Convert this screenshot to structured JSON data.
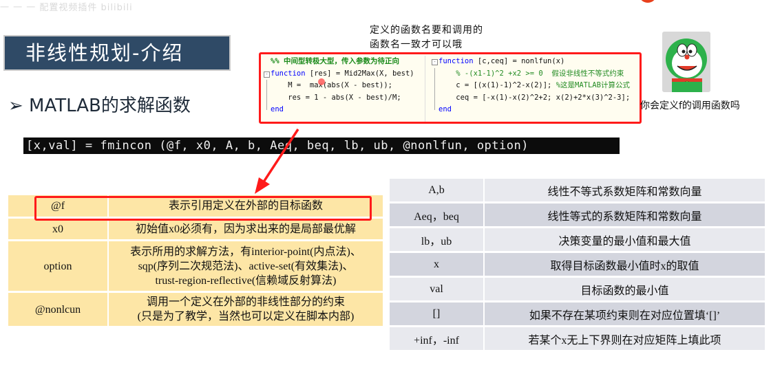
{
  "watermark": "一 一 一 配置视频插件 bilibili",
  "title": "非线性规划-介绍",
  "annotation_note": "定义的函数名要和调用的\n函数名一致才可以哦",
  "subtitle": "➢ MATLAB的求解函数",
  "code": {
    "left": [
      {
        "fold": "",
        "parts": [
          {
            "cls": "cmt-bold",
            "t": "%% 中间型转极大型，传入参数为待正向"
          }
        ]
      },
      {
        "fold": "-",
        "parts": [
          {
            "cls": "kw",
            "t": "function"
          },
          {
            "cls": "plain",
            "t": " [res] = Mid2Max(X, best)"
          }
        ]
      },
      {
        "fold": "|",
        "parts": [
          {
            "cls": "plain",
            "t": "    M =  max(abs(X - best));"
          }
        ]
      },
      {
        "fold": "|",
        "parts": [
          {
            "cls": "plain",
            "t": "    res = 1 - abs(X - best)/M;"
          }
        ]
      },
      {
        "fold": "L",
        "parts": [
          {
            "cls": "kw",
            "t": "end"
          }
        ]
      }
    ],
    "right": [
      {
        "fold": "-",
        "parts": [
          {
            "cls": "kw",
            "t": "function"
          },
          {
            "cls": "plain",
            "t": " [c,ceq] = nonlfun(x)"
          }
        ]
      },
      {
        "fold": "|",
        "parts": [
          {
            "cls": "cmt",
            "t": "    % -(x1-1)^2 +x2 >= 0  假设非线性不等式约束"
          }
        ]
      },
      {
        "fold": "|",
        "parts": [
          {
            "cls": "plain",
            "t": "    c = [(x(1)-1)^2-x(2)]; "
          },
          {
            "cls": "cmt",
            "t": "%这是MATLAB计算公式"
          }
        ]
      },
      {
        "fold": "|",
        "parts": [
          {
            "cls": "plain",
            "t": "    ceq = [-x(1)-x(2)^2+2; x(2)+2*x(3)^2-3];"
          }
        ]
      },
      {
        "fold": "L",
        "parts": [
          {
            "cls": "kw",
            "t": "end"
          }
        ]
      }
    ]
  },
  "avatar_caption": "你会定义f的调用函数吗",
  "command": "[x,val] = fmincon (@f, x0, A, b, Aeq, beq, lb, ub, @nonlfun, option)",
  "left_table": [
    [
      "@f",
      "表示引用定义在外部的目标函数"
    ],
    [
      "x0",
      "初始值x0必须有，因为求出来的是局部最优解"
    ],
    [
      "option",
      "表示所用的求解方法，有interior-point(内点法)、\nsqp(序列二次规范法)、active-set(有效集法)、\ntrust-region-reflective(信赖域反射算法)"
    ],
    [
      "@nonlcun",
      "调用一个定义在外部的非线性部分的约束\n(只是为了教学，当然也可以定义在脚本内部)"
    ]
  ],
  "right_table": [
    [
      "A,b",
      "线性不等式系数矩阵和常数向量"
    ],
    [
      "Aeq，beq",
      "线性等式的系数矩阵和常数向量"
    ],
    [
      "lb，ub",
      "决策变量的最小值和最大值"
    ],
    [
      "x",
      "取得目标函数最小值时x的取值"
    ],
    [
      "val",
      "目标函数的最小值"
    ],
    [
      "[]",
      "如果不存在某项约束则在对应位置填‘[]’"
    ],
    [
      "+inf，-inf",
      "若某个x无上下界则在对应矩阵上填此项"
    ]
  ],
  "colors": {
    "title_bg": "#2f4a66",
    "highlight": "#ff1a1a",
    "left_table_bg": "#fde6a6",
    "right_table_odd": "#e8e9ee",
    "right_table_even": "#d3d5de"
  }
}
